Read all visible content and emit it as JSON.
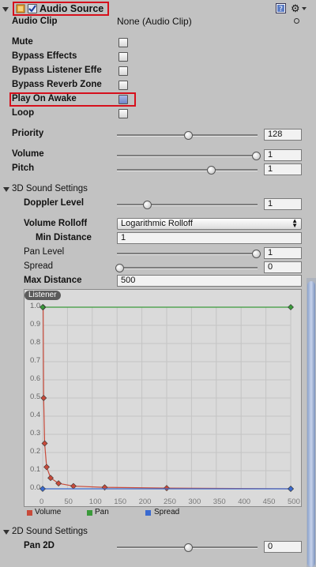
{
  "component": {
    "title": "Audio Source",
    "enabled": true,
    "icons": {
      "speaker": "speaker-icon",
      "help": "help-icon",
      "gear": "gear-icon"
    }
  },
  "audio_clip": {
    "label": "Audio Clip",
    "value": "None (Audio Clip)"
  },
  "toggles": [
    {
      "label": "Mute",
      "checked": false
    },
    {
      "label": "Bypass Effects",
      "checked": false
    },
    {
      "label": "Bypass Listener Effe",
      "checked": false
    },
    {
      "label": "Bypass Reverb Zone",
      "checked": false
    },
    {
      "label": "Play On Awake",
      "checked": true
    },
    {
      "label": "Loop",
      "checked": false
    }
  ],
  "priority": {
    "label": "Priority",
    "value": "128",
    "fraction": 0.5
  },
  "volume": {
    "label": "Volume",
    "value": "1",
    "fraction": 1.0
  },
  "pitch": {
    "label": "Pitch",
    "value": "1",
    "fraction": 0.66
  },
  "sound3d": {
    "header": "3D Sound Settings",
    "doppler": {
      "label": "Doppler Level",
      "value": "1",
      "fraction": 0.2
    },
    "rolloff": {
      "label": "Volume Rolloff",
      "value": "Logarithmic Rolloff"
    },
    "min_distance": {
      "label": "Min Distance",
      "value": "1"
    },
    "pan_level": {
      "label": "Pan Level",
      "value": "1",
      "fraction": 1.0
    },
    "spread": {
      "label": "Spread",
      "value": "0",
      "fraction": 0.0
    },
    "max_distance": {
      "label": "Max Distance",
      "value": "500"
    }
  },
  "graph": {
    "listener_label": "Listener",
    "y_ticks": [
      "1.0",
      "0.9",
      "0.8",
      "0.7",
      "0.6",
      "0.5",
      "0.4",
      "0.3",
      "0.2",
      "0.1",
      "0.0"
    ],
    "x_ticks": [
      "0",
      "50",
      "100",
      "150",
      "200",
      "250",
      "300",
      "350",
      "400",
      "450",
      "500"
    ],
    "legend": [
      {
        "label": "Volume",
        "color": "#c84a3a"
      },
      {
        "label": "Pan",
        "color": "#3a9a3a"
      },
      {
        "label": "Spread",
        "color": "#3a6ad0"
      }
    ]
  },
  "chart_data": {
    "type": "line",
    "xlim": [
      0,
      500
    ],
    "ylim": [
      0,
      1
    ],
    "grid": true,
    "legend_position": "bottom",
    "series": [
      {
        "name": "Volume",
        "points": [
          [
            1,
            1.0
          ],
          [
            2,
            0.5
          ],
          [
            4,
            0.25
          ],
          [
            8,
            0.12
          ],
          [
            16,
            0.06
          ],
          [
            32,
            0.03
          ],
          [
            62,
            0.015
          ],
          [
            125,
            0.008
          ],
          [
            250,
            0.004
          ],
          [
            500,
            0.0
          ]
        ]
      },
      {
        "name": "Pan",
        "points": [
          [
            0,
            1.0
          ],
          [
            500,
            1.0
          ]
        ]
      },
      {
        "name": "Spread",
        "points": [
          [
            0,
            0.0
          ],
          [
            500,
            0.0
          ]
        ]
      }
    ]
  },
  "sound2d": {
    "header": "2D Sound Settings",
    "pan2d": {
      "label": "Pan 2D",
      "value": "0",
      "fraction": 0.5
    }
  },
  "colors": {
    "highlight": "#d6101c",
    "panel": "#c2c2c2",
    "accent": "#5b7cc4"
  }
}
